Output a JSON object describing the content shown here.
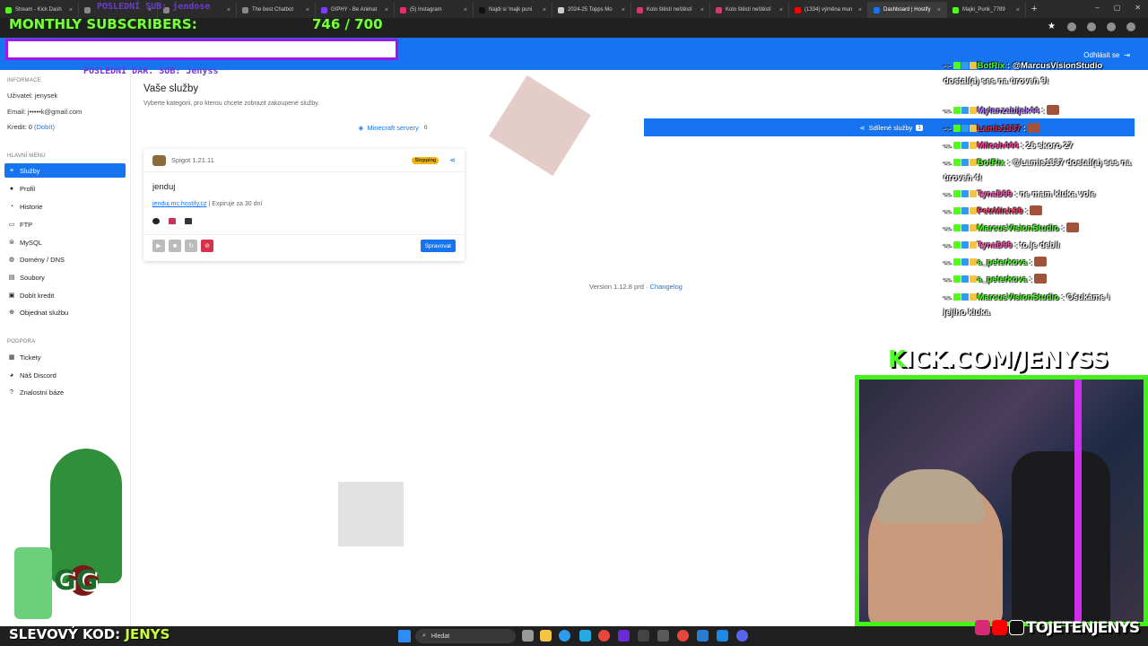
{
  "browser": {
    "tabs": [
      {
        "label": "Stream - Kick Dash",
        "color": "#53fc18",
        "active": false
      },
      {
        "label": "",
        "color": "#888888",
        "active": false
      },
      {
        "label": "",
        "color": "#888888",
        "active": false
      },
      {
        "label": "The best Chatbot",
        "color": "#888888",
        "active": false
      },
      {
        "label": "GIPHY - Be Animat",
        "color": "#7a3cff",
        "active": false
      },
      {
        "label": "(5) Instagram",
        "color": "#e1306c",
        "active": false
      },
      {
        "label": "Najdi si 'majk puni",
        "color": "#111111",
        "active": false
      },
      {
        "label": "2024-25 Topps Mo",
        "color": "#cccccc",
        "active": false
      },
      {
        "label": "Kolo štěstí neštěstí",
        "color": "#d23b6c",
        "active": false
      },
      {
        "label": "Kolo štěstí neštěstí",
        "color": "#d23b6c",
        "active": false
      },
      {
        "label": "(1334) výměna mun",
        "color": "#ff0000",
        "active": false
      },
      {
        "label": "Dashboard | Hostify",
        "color": "#1674f1",
        "active": true
      },
      {
        "label": "Majki_Punk_7789",
        "color": "#53fc18",
        "active": false
      }
    ]
  },
  "header": {
    "logout_label": "Odhlásit se"
  },
  "sidebar": {
    "info_heading": "Informace",
    "user_line": "Uživatel: jenysek",
    "email_line": "Email: j•••••k@gmail.com",
    "credit_prefix": "Kredit: 0 ",
    "credit_link": "(Dobít)",
    "main_menu_heading": "Hlavní menu",
    "items": [
      {
        "label": "Služby",
        "icon": "list-icon",
        "glyph": "≡",
        "active": true
      },
      {
        "label": "Profil",
        "icon": "user-icon",
        "glyph": "●",
        "active": false
      },
      {
        "label": "Historie",
        "icon": "history-icon",
        "glyph": "◔",
        "active": false
      },
      {
        "label": "FTP",
        "icon": "folder-icon",
        "glyph": "▭",
        "active": false
      },
      {
        "label": "MySQL",
        "icon": "database-icon",
        "glyph": "⊜",
        "active": false
      },
      {
        "label": "Domény / DNS",
        "icon": "globe-icon",
        "glyph": "◍",
        "active": false
      },
      {
        "label": "Soubory",
        "icon": "file-icon",
        "glyph": "▤",
        "active": false
      },
      {
        "label": "Dobít kredit",
        "icon": "wallet-icon",
        "glyph": "▣",
        "active": false
      },
      {
        "label": "Objednat službu",
        "icon": "cart-icon",
        "glyph": "⊕",
        "active": false
      }
    ],
    "support_heading": "Podpora",
    "support_items": [
      {
        "label": "Tickety",
        "icon": "ticket-icon",
        "glyph": "▦"
      },
      {
        "label": "Náš Discord",
        "icon": "discord-icon",
        "glyph": "◕"
      },
      {
        "label": "Znalostní báze",
        "icon": "question-icon",
        "glyph": "?"
      }
    ]
  },
  "main": {
    "title": "Vaše služby",
    "subtitle": "Vyberte kategorii, pro kterou chcete zobrazit zakoupené služby.",
    "tab_minecraft": "Minecraft servery",
    "tab_minecraft_count": "0",
    "tab_shared": "Sdílené služby",
    "tab_shared_count": "1",
    "card": {
      "version": "Spigot 1.21.11",
      "status": "Stopping",
      "name": "jenduj",
      "address": "jenduj.mc.hostify.cz",
      "expiry": " | Expiruje za 30 dní",
      "manage_label": "Spravovat"
    },
    "version_text": "Version 1.12.8 prd · ",
    "changelog": "Changelog"
  },
  "overlay": {
    "sub_goal_title": "MONTHLY SUBSCRIBERS:",
    "sub_goal_count": "746 / 700",
    "sub_goal_current": 746,
    "sub_goal_target": 700,
    "last_donation": "POSLEDNÍ DAR. SUB: Jenyss",
    "last_sub": "POSLEDNÍ SUB: jendose",
    "kick_url_k": "K",
    "kick_url_rest": "ICK.COM/JENYSS",
    "socials_handle": "TOJETENJENYS",
    "discount_label": "SLEVOVÝ KOD: ",
    "discount_code": "JENYS",
    "gg_text": "GG"
  },
  "chat": [
    {
      "user": "BotRix",
      "color": "#52ff2a",
      "text": ": @MarcusVisionStudio dostal(a) ses na úroveň 9!",
      "emote": false
    },
    {
      "user": "Mylanzabijak44",
      "color": "#b57cff",
      "text": ":",
      "emote": true
    },
    {
      "user": "Lamis1337",
      "color": "#ff2a4a",
      "text": ":",
      "emote": true
    },
    {
      "user": "Milosh444",
      "color": "#ff3a9a",
      "text": ": 26 skoro 27",
      "emote": false
    },
    {
      "user": "BotRix",
      "color": "#52ff2a",
      "text": ": @Lamis1337 dostal(a) ses na úroveň 4!",
      "emote": false
    },
    {
      "user": "TynaD99",
      "color": "#ff5ab4",
      "text": ": ne mam kluka vole",
      "emote": false
    },
    {
      "user": "PetrMich99",
      "color": "#ff3a6a",
      "text": ":",
      "emote": true
    },
    {
      "user": "MarcusVisionStudio",
      "color": "#52ff2a",
      "text": ":",
      "emote": true
    },
    {
      "user": "TynaD99",
      "color": "#ff5ab4",
      "text": ": to je debil",
      "emote": false
    },
    {
      "user": "a_peterkova",
      "color": "#52ff2a",
      "text": ":",
      "emote": true
    },
    {
      "user": "a_peterkova",
      "color": "#52ff2a",
      "text": ":",
      "emote": true
    },
    {
      "user": "MarcusVisionStudio",
      "color": "#52ff2a",
      "text": ": Ošukáme i jejího kluka",
      "emote": false
    }
  ],
  "taskbar": {
    "search_label": "Hledat"
  }
}
